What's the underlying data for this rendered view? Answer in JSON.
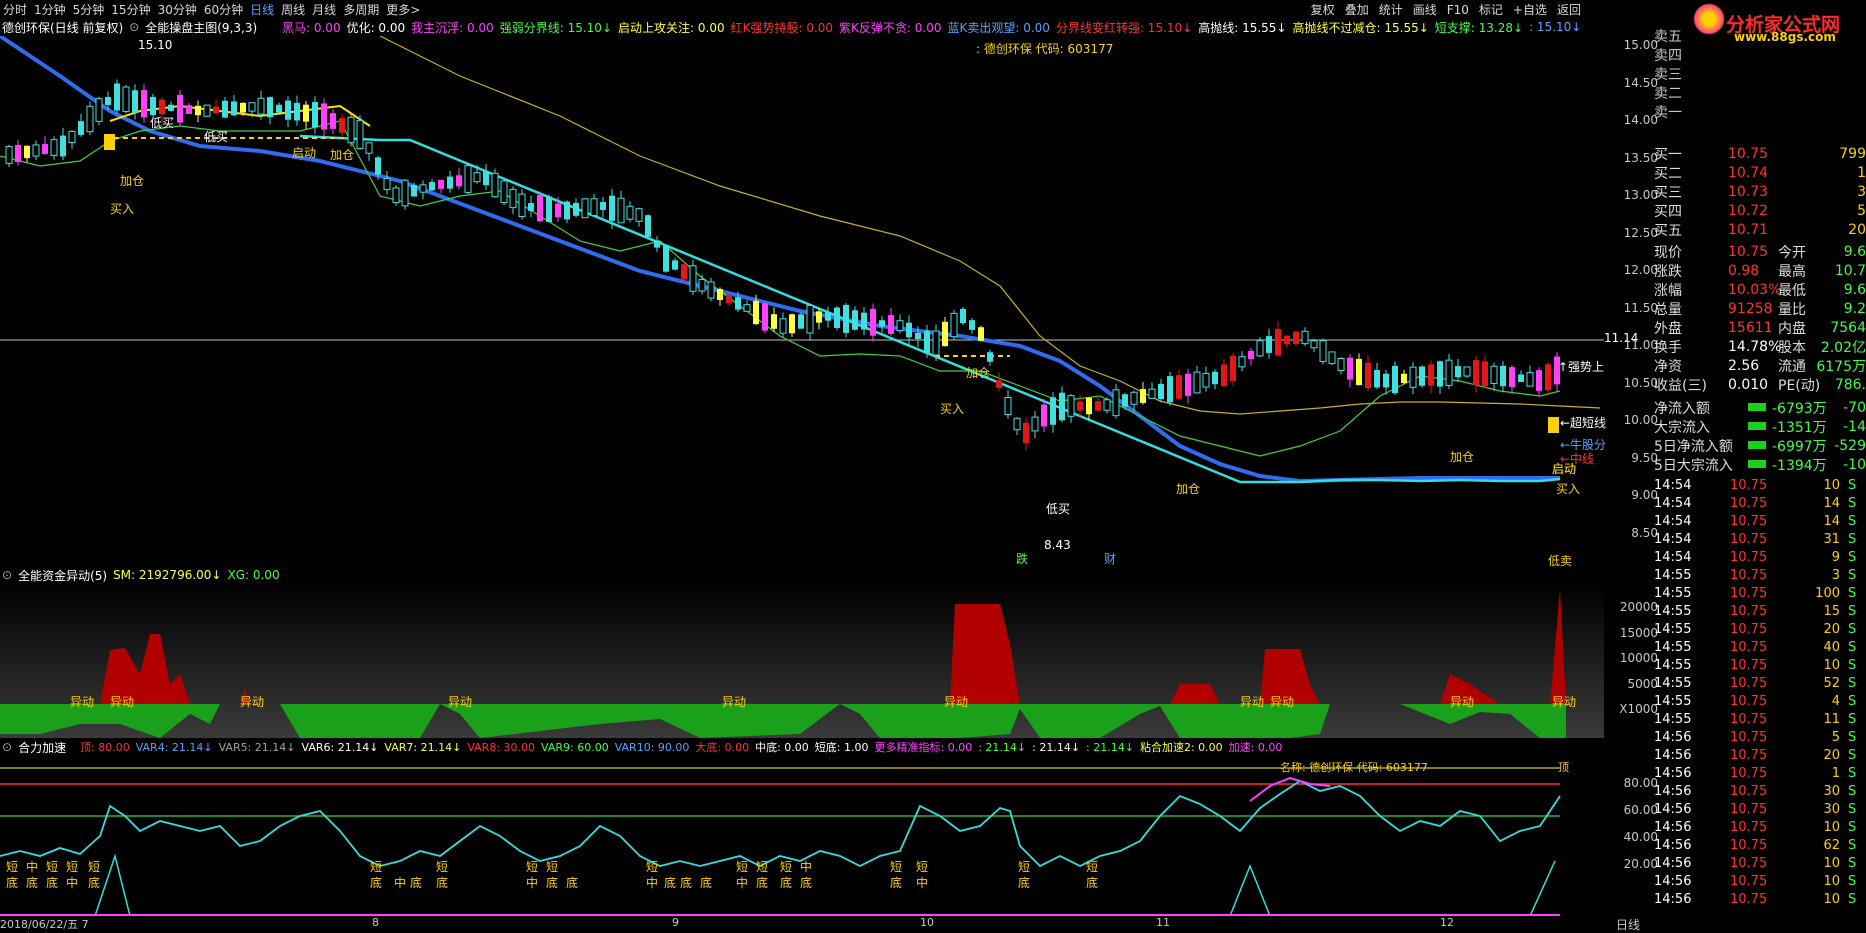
{
  "menu": [
    "分时",
    "1分钟",
    "5分钟",
    "15分钟",
    "30分钟",
    "60分钟",
    "日线",
    "周线",
    "月线",
    "多周期",
    "更多>"
  ],
  "menu_active": "日线",
  "right_menu": [
    "复权",
    "叠加",
    "统计",
    "画线",
    "F10",
    "标记",
    "+自选",
    "返回"
  ],
  "chart_title": "德创环保(日线 前复权)",
  "main_indicator": "全能操盘主图(9,3,3)",
  "main_params": [
    {
      "text": "黑马: 0.00",
      "color": "#ff40ff"
    },
    {
      "text": "优化: 0.00",
      "color": "#ffffff"
    },
    {
      "text": "我主沉浮: 0.00",
      "color": "#ff40ff"
    },
    {
      "text": "强弱分界线: 15.10↓",
      "color": "#40ff40"
    },
    {
      "text": "启动上攻关注: 0.00",
      "color": "#ffff40"
    },
    {
      "text": "红K强势持股: 0.00",
      "color": "#ff3030"
    },
    {
      "text": "紫K反弹不贪: 0.00",
      "color": "#ff40ff"
    },
    {
      "text": "蓝K卖出观望: 0.00",
      "color": "#4fa3ff"
    },
    {
      "text": "分界线变红转强: 15.10↓",
      "color": "#ff3030"
    },
    {
      "text": "高抛线: 15.55↓",
      "color": "#ffffff"
    },
    {
      "text": "高抛线不过减仓: 15.55↓",
      "color": "#ffff40"
    },
    {
      "text": "短支撑: 13.28↓",
      "color": "#40ff40"
    },
    {
      "text": ": 15.10↓",
      "color": "#4fa3ff"
    }
  ],
  "main_annotations": {
    "stock_name": ": 德创环保 代码: 603177",
    "high": "15.10",
    "low": "8.43",
    "crosshair_price": "11.14",
    "labels": [
      "加仓",
      "买入",
      "低买",
      "低买",
      "启动",
      "加仓",
      "加仓",
      "买入",
      "低买",
      "加仓",
      "启动",
      "加仓",
      "启动",
      "买入",
      "跌",
      "财",
      "↑强势上",
      "←超短线",
      "←牛股分",
      "←中线",
      "低卖"
    ]
  },
  "price_axis": [
    "15.00",
    "14.50",
    "14.00",
    "13.50",
    "13.00",
    "12.50",
    "12.00",
    "11.50",
    "11.00",
    "10.50",
    "10.00",
    "9.50",
    "9.00",
    "8.50"
  ],
  "fund_indicator": {
    "title": "全能资金异动(5)",
    "sm": "SM: 2192796.00↓",
    "xg": "XG: 0.00",
    "axis": [
      "20000",
      "15000",
      "10000",
      "5000",
      "X1000"
    ],
    "label": "异动"
  },
  "accel_indicator": {
    "title": "合力加速",
    "params": [
      {
        "text": "顶: 80.00",
        "color": "#ff3030"
      },
      {
        "text": "VAR4: 21.14↓",
        "color": "#4fa3ff"
      },
      {
        "text": "VAR5: 21.14↓",
        "color": "#a0a0a0"
      },
      {
        "text": "VAR6: 21.14↓",
        "color": "#ffffff"
      },
      {
        "text": "VAR7: 21.14↓",
        "color": "#ffff40"
      },
      {
        "text": "VAR8: 30.00",
        "color": "#ff3030"
      },
      {
        "text": "VAR9: 60.00",
        "color": "#40ff40"
      },
      {
        "text": "VAR10: 90.00",
        "color": "#4fa3ff"
      },
      {
        "text": "大底: 0.00",
        "color": "#ff3030"
      },
      {
        "text": "中底: 0.00",
        "color": "#ffffff"
      },
      {
        "text": "短底: 1.00",
        "color": "#ffffff"
      },
      {
        "text": "更多精准指标: 0.00",
        "color": "#ff40ff"
      },
      {
        "text": ": 21.14↓",
        "color": "#40ff40"
      },
      {
        "text": ": 21.14↓",
        "color": "#ffffff"
      },
      {
        "text": ": 21.14↓",
        "color": "#40ff40"
      },
      {
        "text": "粘合加速2: 0.00",
        "color": "#ffff40"
      },
      {
        "text": "加速: 0.00",
        "color": "#ff40ff"
      }
    ],
    "name_line": "名称: 德创环保 代码: 603177",
    "top_label": "顶",
    "axis": [
      "80.00",
      "60.00",
      "40.00",
      "20.00"
    ]
  },
  "date_axis": [
    "2018/06/22/五 7",
    "8",
    "9",
    "10",
    "11",
    "12"
  ],
  "side": {
    "sell_labels": [
      "卖五",
      "卖四",
      "卖三",
      "卖二",
      "卖一"
    ],
    "buy": [
      {
        "label": "买一",
        "price": "10.75",
        "vol": "799"
      },
      {
        "label": "买二",
        "price": "10.74",
        "vol": "1"
      },
      {
        "label": "买三",
        "price": "10.73",
        "vol": "3"
      },
      {
        "label": "买四",
        "price": "10.72",
        "vol": "5"
      },
      {
        "label": "买五",
        "price": "10.71",
        "vol": "20"
      }
    ],
    "stats": [
      {
        "l1": "现价",
        "v1": "10.75",
        "l2": "今开",
        "v2": "9.6"
      },
      {
        "l1": "涨跌",
        "v1": "0.98",
        "l2": "最高",
        "v2": "10.7"
      },
      {
        "l1": "涨幅",
        "v1": "10.03%",
        "l2": "最低",
        "v2": "9.6"
      },
      {
        "l1": "总量",
        "v1": "91258",
        "l2": "量比",
        "v2": "9.2"
      },
      {
        "l1": "外盘",
        "v1": "15611",
        "l2": "内盘",
        "v2": "7564"
      },
      {
        "l1": "换手",
        "v1": "14.78%",
        "l2": "股本",
        "v2": "2.02亿"
      },
      {
        "l1": "净资",
        "v1": "2.56",
        "l2": "流通",
        "v2": "6175万"
      },
      {
        "l1": "收益(三)",
        "v1": "0.010",
        "l2": "PE(动)",
        "v2": "786."
      }
    ],
    "flows": [
      {
        "label": "净流入额",
        "v1": "-6793万",
        "v2": "-70"
      },
      {
        "label": "大宗流入",
        "v1": "-1351万",
        "v2": "-14"
      },
      {
        "label": "5日净流入额",
        "v1": "-6997万",
        "v2": "-529"
      },
      {
        "label": "5日大宗流入",
        "v1": "-1394万",
        "v2": "-10"
      }
    ],
    "ticks": [
      {
        "t": "14:54",
        "p": "10.75",
        "v": "10",
        "s": "S"
      },
      {
        "t": "14:54",
        "p": "10.75",
        "v": "14",
        "s": "S"
      },
      {
        "t": "14:54",
        "p": "10.75",
        "v": "14",
        "s": "S"
      },
      {
        "t": "14:54",
        "p": "10.75",
        "v": "31",
        "s": "S"
      },
      {
        "t": "14:54",
        "p": "10.75",
        "v": "9",
        "s": "S"
      },
      {
        "t": "14:55",
        "p": "10.75",
        "v": "3",
        "s": "S"
      },
      {
        "t": "14:55",
        "p": "10.75",
        "v": "100",
        "s": "S"
      },
      {
        "t": "14:55",
        "p": "10.75",
        "v": "15",
        "s": "S"
      },
      {
        "t": "14:55",
        "p": "10.75",
        "v": "20",
        "s": "S"
      },
      {
        "t": "14:55",
        "p": "10.75",
        "v": "40",
        "s": "S"
      },
      {
        "t": "14:55",
        "p": "10.75",
        "v": "10",
        "s": "S"
      },
      {
        "t": "14:55",
        "p": "10.75",
        "v": "52",
        "s": "S"
      },
      {
        "t": "14:55",
        "p": "10.75",
        "v": "4",
        "s": "S"
      },
      {
        "t": "14:55",
        "p": "10.75",
        "v": "11",
        "s": "S"
      },
      {
        "t": "14:56",
        "p": "10.75",
        "v": "5",
        "s": "S"
      },
      {
        "t": "14:56",
        "p": "10.75",
        "v": "20",
        "s": "S"
      },
      {
        "t": "14:56",
        "p": "10.75",
        "v": "1",
        "s": "S"
      },
      {
        "t": "14:56",
        "p": "10.75",
        "v": "30",
        "s": "S"
      },
      {
        "t": "14:56",
        "p": "10.75",
        "v": "30",
        "s": "S"
      },
      {
        "t": "14:56",
        "p": "10.75",
        "v": "10",
        "s": "S"
      },
      {
        "t": "14:56",
        "p": "10.75",
        "v": "62",
        "s": "S"
      },
      {
        "t": "14:56",
        "p": "10.75",
        "v": "10",
        "s": "S"
      },
      {
        "t": "14:56",
        "p": "10.75",
        "v": "10",
        "s": "S"
      },
      {
        "t": "14:56",
        "p": "10.75",
        "v": "10",
        "s": "S"
      }
    ],
    "bottom_tab": "日线"
  },
  "logo": {
    "text": "分析家公式网",
    "url": "www.88gs.com"
  }
}
